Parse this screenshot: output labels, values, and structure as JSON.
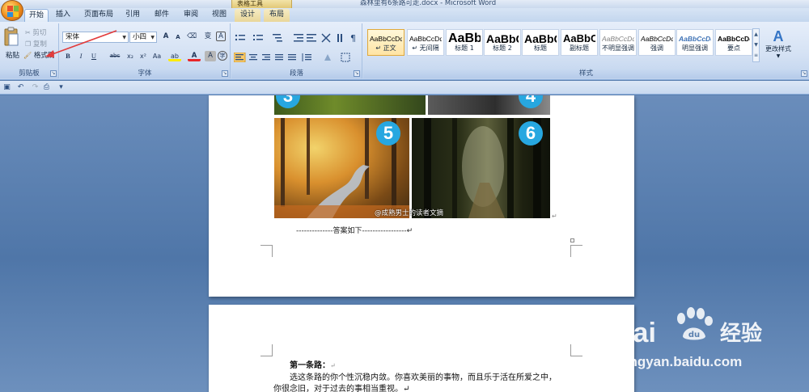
{
  "titlebar": {
    "doc_title": "森林里有6条路可走.docx - Microsoft Word",
    "context_group": "表格工具"
  },
  "tabs": [
    {
      "label": "开始",
      "active": true
    },
    {
      "label": "插入"
    },
    {
      "label": "页面布局"
    },
    {
      "label": "引用"
    },
    {
      "label": "邮件"
    },
    {
      "label": "审阅"
    },
    {
      "label": "视图"
    },
    {
      "label": "设计",
      "contextual": true
    },
    {
      "label": "布局",
      "contextual": true
    }
  ],
  "clipboard": {
    "paste": "粘贴",
    "cut": "剪切",
    "copy": "复制",
    "format_painter": "格式刷",
    "label": "剪贴板"
  },
  "font": {
    "name": "宋体",
    "size": "小四",
    "label": "字体",
    "grow": "A",
    "shrink": "A",
    "clear_format": "⌫",
    "phonetic": "变",
    "border_char": "A",
    "bold": "B",
    "italic": "I",
    "underline": "U",
    "strike": "abc",
    "subscript": "x₂",
    "superscript": "x²",
    "change_case": "Aa",
    "highlight": "ab",
    "font_color": "A",
    "shading": "A",
    "enclose": "字"
  },
  "paragraph": {
    "label": "段落",
    "icons": [
      "bullets-icon",
      "numbering-icon",
      "multilevel-icon",
      "outdent-icon",
      "indent-icon",
      "chinese-layout-icon",
      "sort-icon",
      "show-marks-icon"
    ],
    "align_icons": [
      "align-left-icon",
      "align-center-icon",
      "align-right-icon",
      "justify-icon",
      "distributed-icon",
      "line-spacing-icon",
      "shading-icon",
      "borders-icon"
    ]
  },
  "styles": {
    "label": "样式",
    "change_styles": "更改样式",
    "items": [
      {
        "sample": "AaBbCcDd",
        "name": "↵ 正文",
        "selected": true
      },
      {
        "sample": "AaBbCcDd",
        "name": "↵ 无间隔"
      },
      {
        "sample": "AaBb",
        "name": "标题 1"
      },
      {
        "sample": "AaBbC",
        "name": "标题 2"
      },
      {
        "sample": "AaBbC",
        "name": "标题"
      },
      {
        "sample": "AaBbC",
        "name": "副标题"
      },
      {
        "sample": "AaBbCcDd",
        "name": "不明显强调"
      },
      {
        "sample": "AaBbCcDd",
        "name": "强调"
      },
      {
        "sample": "AaBbCcDd",
        "name": "明显强调"
      },
      {
        "sample": "AaBbCcDd",
        "name": "要点"
      }
    ]
  },
  "document": {
    "photo_numbers": [
      "3",
      "4",
      "5",
      "6"
    ],
    "image_credit": "@成熟男士的读者文摘",
    "separator": "--------------答案如下-----------------↵",
    "para_mark": "↵",
    "heading": "第一条路：",
    "heading_mark": "↵",
    "body_line1": "选这条路的你个性沉稳内敛。你喜欢美丽的事物，而且乐于活在所爱之中，",
    "body_line2": "你很念旧，对于过去的事相当重视。↵"
  },
  "watermark": {
    "brand": "Bai",
    "brand_suffix": "经验",
    "url": "jingyan.baidu.com"
  },
  "colors": {
    "ribbon_top": "#e6eefa",
    "doc_bg": "#5a7fae",
    "badge": "#27a7e0",
    "highlight_yellow": "#ffeb00",
    "font_red": "#e8262a",
    "arrow_red": "#e23b3b"
  }
}
